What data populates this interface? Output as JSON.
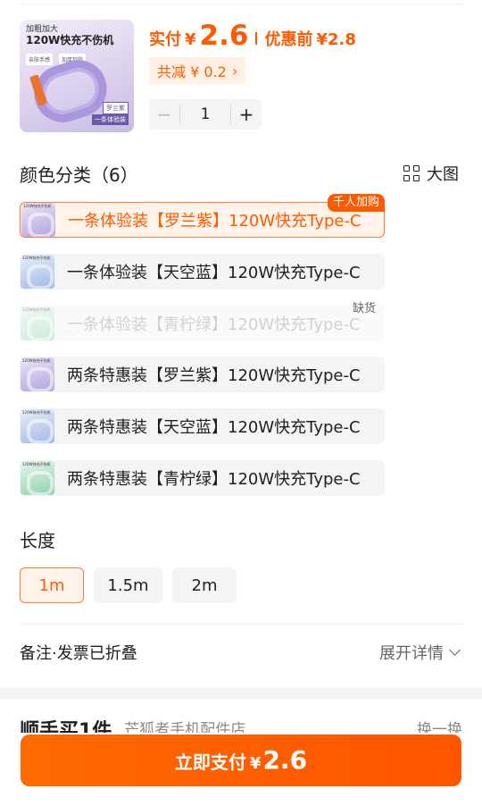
{
  "product": {
    "thumb_line1": "加粗加大",
    "thumb_line2": "120W快充不伤机",
    "thumb_chip1": "亲肤手感",
    "thumb_chip2": "加厚软胶",
    "thumb_tag1": "罗兰紫",
    "thumb_tag2": "一条体验装"
  },
  "price": {
    "label": "实付",
    "currency": "¥",
    "amount": "2.6",
    "original_label": "优惠前",
    "original": "¥2.8"
  },
  "discount": {
    "text": "共减 ¥ 0.2",
    "chevron": "›"
  },
  "quantity": {
    "minus": "−",
    "value": "1",
    "plus": "+"
  },
  "colors": {
    "title": "颜色分类（6）",
    "big_image_label": "大图",
    "badge_hot": "千人加购",
    "badge_soldout": "缺货",
    "options": [
      {
        "label": "一条体验装【罗兰紫】120W快充Type-C",
        "swatch": "purple",
        "selected": true
      },
      {
        "label": "一条体验装【天空蓝】120W快充Type-C",
        "swatch": "blue"
      },
      {
        "label": "一条体验装【青柠绿】120W快充Type-C",
        "swatch": "green",
        "disabled": true
      },
      {
        "label": "两条特惠装【罗兰紫】120W快充Type-C",
        "swatch": "purple"
      },
      {
        "label": "两条特惠装【天空蓝】120W快充Type-C",
        "swatch": "blue"
      },
      {
        "label": "两条特惠装【青柠绿】120W快充Type-C",
        "swatch": "green"
      }
    ],
    "swatch_text": "120W快充不伤机"
  },
  "length": {
    "title": "长度",
    "options": [
      "1m",
      "1.5m",
      "2m"
    ],
    "selected": "1m"
  },
  "notes": {
    "label": "备注·发票已折叠",
    "expand": "展开详情"
  },
  "peek": {
    "title": "顺手买1件",
    "subtitle": "芒狐者手机配件店",
    "right": "换一换"
  },
  "pay": {
    "label": "立即支付",
    "currency": "¥",
    "amount": "2.6"
  },
  "colors_theme": {
    "accent": "#ff5a00",
    "accent_bg": "#fff3ea",
    "option_bg": "#f3f4f6"
  }
}
